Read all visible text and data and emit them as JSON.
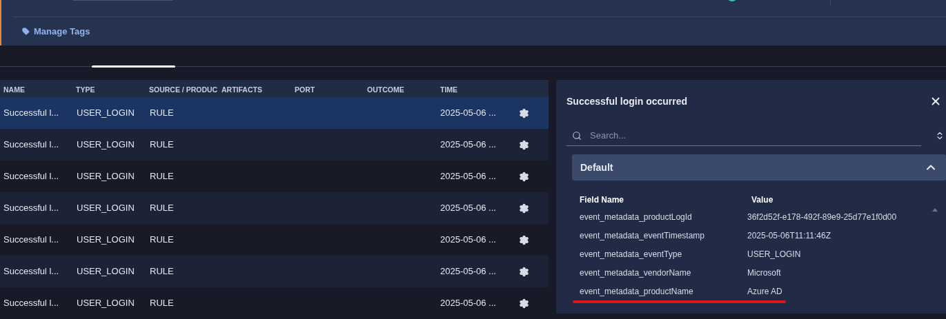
{
  "top_panel": {
    "action": "Manage Tags"
  },
  "table": {
    "columns": [
      "NAME",
      "TYPE",
      "SOURCE / PRODUC",
      "ARTIFACTS",
      "PORT",
      "OUTCOME",
      "TIME"
    ],
    "rows": [
      {
        "name": "Successful l...",
        "type": "USER_LOGIN",
        "source": "RULE",
        "time": "2025-05-06 ...",
        "selected": true
      },
      {
        "name": "Successful l...",
        "type": "USER_LOGIN",
        "source": "RULE",
        "time": "2025-05-06 ...",
        "selected": false
      },
      {
        "name": "Successful l...",
        "type": "USER_LOGIN",
        "source": "RULE",
        "time": "2025-05-06 ...",
        "selected": false
      },
      {
        "name": "Successful l...",
        "type": "USER_LOGIN",
        "source": "RULE",
        "time": "2025-05-06 ...",
        "selected": false
      },
      {
        "name": "Successful l...",
        "type": "USER_LOGIN",
        "source": "RULE",
        "time": "2025-05-06 ...",
        "selected": false
      },
      {
        "name": "Successful l...",
        "type": "USER_LOGIN",
        "source": "RULE",
        "time": "2025-05-06 ...",
        "selected": false
      },
      {
        "name": "Successful l...",
        "type": "USER_LOGIN",
        "source": "RULE",
        "time": "2025-05-06 ...",
        "selected": false
      }
    ]
  },
  "detail": {
    "title": "Successful login occurred",
    "search": {
      "placeholder": "Search..."
    },
    "section": {
      "title": "Default",
      "expanded": true,
      "columns": [
        "Field Name",
        "Value"
      ],
      "fields": [
        {
          "name": "event_metadata_productLogId",
          "value": "36f2d52f-e178-492f-89e9-25d77e1f0d00"
        },
        {
          "name": "event_metadata_eventTimestamp",
          "value": "2025-05-06T11:11:46Z"
        },
        {
          "name": "event_metadata_eventType",
          "value": "USER_LOGIN"
        },
        {
          "name": "event_metadata_vendorName",
          "value": "Microsoft"
        },
        {
          "name": "event_metadata_productName",
          "value": "Azure AD"
        }
      ]
    }
  }
}
